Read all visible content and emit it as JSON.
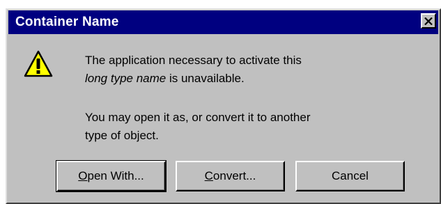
{
  "window": {
    "title": "Container Name",
    "close_icon": "close-icon"
  },
  "dialog": {
    "icon": "warning-icon",
    "message1_line1": "The application necessary to activate this",
    "message1_italic": "long type name",
    "message1_rest": " is unavailable.",
    "message2_line1": "You may open it as, or convert it to another",
    "message2_line2": "type of object."
  },
  "buttons": {
    "open_with_mnemonic": "O",
    "open_with_rest": "pen With...",
    "convert_mnemonic": "C",
    "convert_rest": "onvert...",
    "cancel": "Cancel"
  },
  "colors": {
    "titlebar": "#000080",
    "face": "#c0c0c0",
    "warning": "#ffff00"
  }
}
